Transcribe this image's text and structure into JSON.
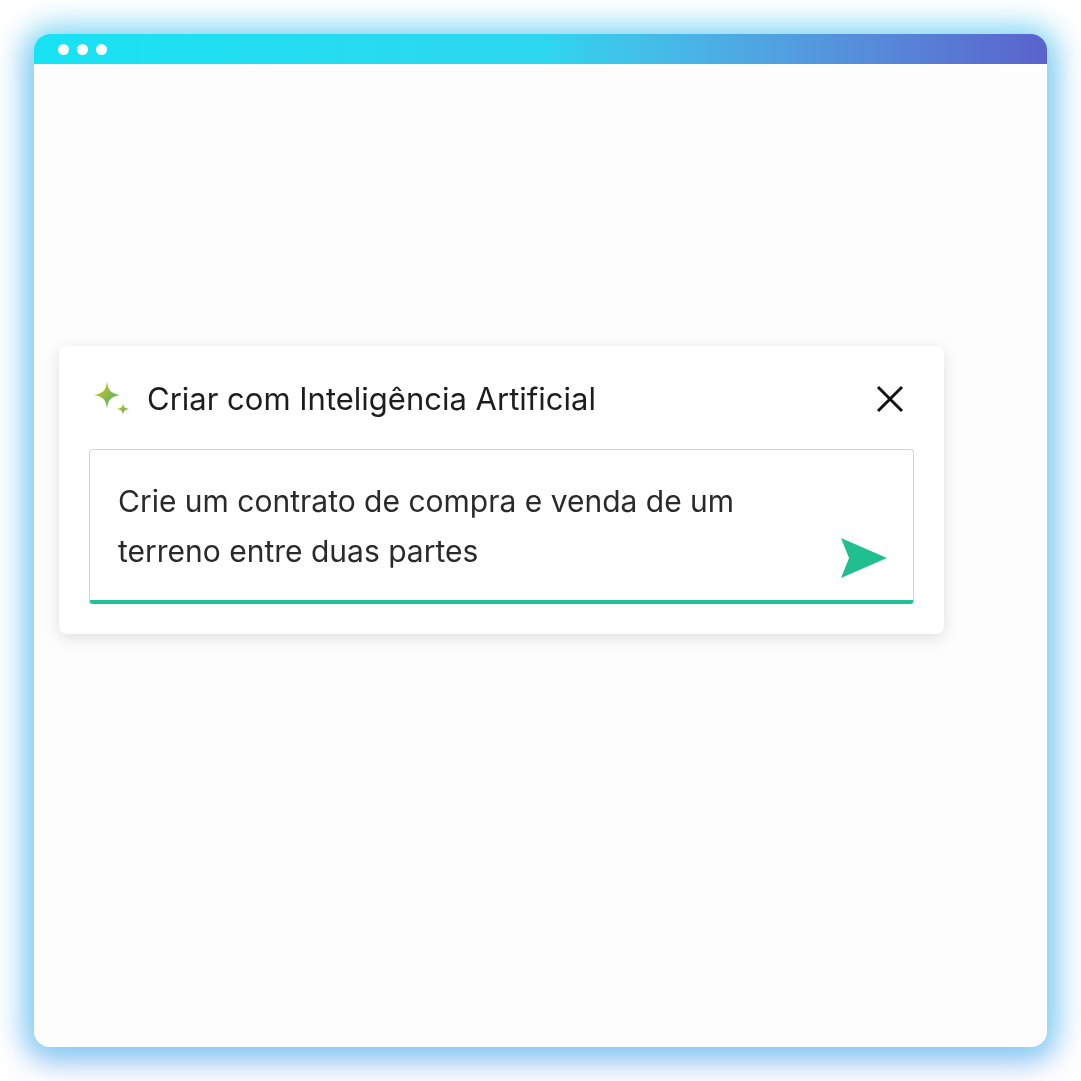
{
  "dialog": {
    "title": "Criar com Inteligência Artificial"
  },
  "prompt": {
    "value": "Crie um contrato de compra e venda de um terreno entre duas partes"
  }
}
